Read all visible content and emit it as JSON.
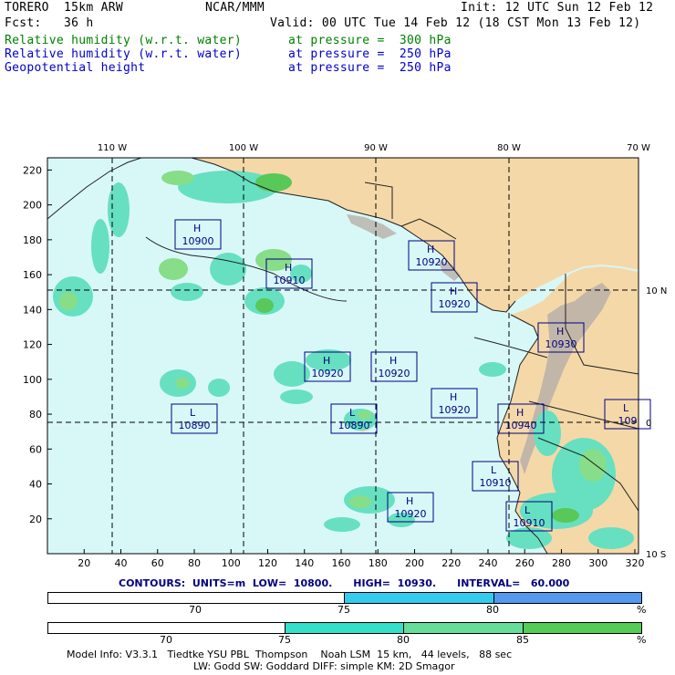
{
  "header": {
    "model": "TORERO  15km ARW",
    "org": "NCAR/MMM",
    "init": "Init: 12 UTC Sun 12 Feb 12",
    "fcst": "Fcst:   36 h",
    "valid": "Valid: 00 UTC Tue 14 Feb 12 (18 CST Mon 13 Feb 12)",
    "fields": [
      {
        "name": "Relative humidity (w.r.t. water)",
        "level": "at pressure =  300 hPa",
        "color": "#008000"
      },
      {
        "name": "Relative humidity (w.r.t. water)",
        "level": "at pressure =  250 hPa",
        "color": "#0000cc"
      },
      {
        "name": "Geopotential height",
        "level": "at pressure =  250 hPa",
        "color": "#0000cc"
      }
    ]
  },
  "map": {
    "lon_labels": [
      {
        "text": "110 W",
        "lon": -110
      },
      {
        "text": "100 W",
        "lon": -100
      },
      {
        "text": "90 W",
        "lon": -90
      },
      {
        "text": "80 W",
        "lon": -80
      },
      {
        "text": "70 W",
        "lon": -70
      }
    ],
    "lat_labels": [
      {
        "text": "10 N",
        "lat": 10
      },
      {
        "text": "0",
        "lat": 0
      },
      {
        "text": "10 S",
        "lat": -10
      }
    ],
    "x_ticks": [
      "20",
      "40",
      "60",
      "80",
      "100",
      "120",
      "140",
      "160",
      "180",
      "200",
      "220",
      "240",
      "260",
      "280",
      "300",
      "320"
    ],
    "y_ticks": [
      "20",
      "40",
      "60",
      "80",
      "100",
      "120",
      "140",
      "160",
      "180",
      "200",
      "220"
    ],
    "centers": [
      {
        "type": "H",
        "value": "10900"
      },
      {
        "type": "H",
        "value": "10910"
      },
      {
        "type": "H",
        "value": "10920"
      },
      {
        "type": "H",
        "value": "10920"
      },
      {
        "type": "H",
        "value": "10920"
      },
      {
        "type": "H",
        "value": "10920"
      },
      {
        "type": "H",
        "value": "10930"
      },
      {
        "type": "H",
        "value": "10940"
      },
      {
        "type": "H",
        "value": "10920"
      },
      {
        "type": "H",
        "value": "10920"
      },
      {
        "type": "L",
        "value": "10890"
      },
      {
        "type": "L",
        "value": "10890"
      },
      {
        "type": "L",
        "value": "10910"
      },
      {
        "type": "L",
        "value": "10910"
      },
      {
        "type": "L",
        "value": "109"
      }
    ],
    "colors": {
      "ocean": "#d8f8f8",
      "land": "#f5d8a8",
      "highland": "#b8b0a8",
      "rh70": "#66e0c0",
      "rh80": "#88dd88",
      "rh85": "#58c858",
      "rh_blue": "#00cccc",
      "border": "#202020",
      "contour": "#000080"
    }
  },
  "contours_line": "CONTOURS:  UNITS=m  LOW=  10800.      HIGH=  10930.      INTERVAL=   60.000",
  "colorbars": [
    {
      "ticks": [
        "70",
        "75",
        "80"
      ],
      "unit": "%",
      "colors": [
        "#ffffff",
        "#33ccee",
        "#5599ee"
      ]
    },
    {
      "ticks": [
        "70",
        "75",
        "80",
        "85"
      ],
      "unit": "%",
      "colors": [
        "#ffffff",
        "#33e0c8",
        "#66dd99",
        "#55cc55"
      ]
    }
  ],
  "footer": {
    "line1": "Model Info: V3.3.1   Tiedtke YSU PBL  Thompson    Noah LSM  15 km,   44 levels,   88 sec",
    "line2": "LW: Godd SW: Goddard DIFF: simple KM: 2D Smagor"
  }
}
